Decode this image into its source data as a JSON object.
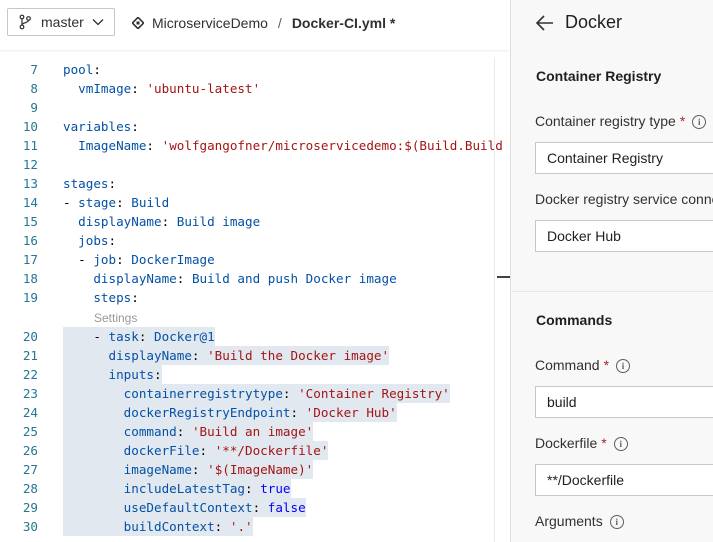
{
  "header": {
    "branch": "master",
    "repo": "MicroserviceDemo",
    "separator": "/",
    "file": "Docker-CI.yml *"
  },
  "editor": {
    "codelens": "Settings",
    "lines": [
      {
        "n": "7",
        "t": "pool:"
      },
      {
        "n": "8",
        "t": "  vmImage: 'ubuntu-latest'"
      },
      {
        "n": "9",
        "t": ""
      },
      {
        "n": "10",
        "t": "variables:"
      },
      {
        "n": "11",
        "t": "  ImageName: 'wolfgangofner/microservicedemo:$(Build.Build"
      },
      {
        "n": "12",
        "t": ""
      },
      {
        "n": "13",
        "t": "stages:"
      },
      {
        "n": "14",
        "t": "- stage: Build"
      },
      {
        "n": "15",
        "t": "  displayName: Build image"
      },
      {
        "n": "16",
        "t": "  jobs:"
      },
      {
        "n": "17",
        "t": "  - job: DockerImage"
      },
      {
        "n": "18",
        "t": "    displayName: Build and push Docker image"
      },
      {
        "n": "19",
        "t": "    steps:"
      },
      {
        "n": "20",
        "t": "    - task: Docker@1"
      },
      {
        "n": "21",
        "t": "      displayName: 'Build the Docker image'"
      },
      {
        "n": "22",
        "t": "      inputs:"
      },
      {
        "n": "23",
        "t": "        containerregistrytype: 'Container Registry'"
      },
      {
        "n": "24",
        "t": "        dockerRegistryEndpoint: 'Docker Hub'"
      },
      {
        "n": "25",
        "t": "        command: 'Build an image'"
      },
      {
        "n": "26",
        "t": "        dockerFile: '**/Dockerfile'"
      },
      {
        "n": "27",
        "t": "        imageName: '$(ImageName)'"
      },
      {
        "n": "28",
        "t": "        includeLatestTag: true"
      },
      {
        "n": "29",
        "t": "        useDefaultContext: false"
      },
      {
        "n": "30",
        "t": "        buildContext: '.'"
      }
    ]
  },
  "panel": {
    "title": "Docker",
    "section_registry": "Container Registry",
    "registry_type_label": "Container registry type",
    "registry_type_value": "Container Registry",
    "service_conn_label": "Docker registry service conne",
    "service_conn_value": "Docker Hub",
    "section_commands": "Commands",
    "command_label": "Command",
    "command_value": "build",
    "dockerfile_label": "Dockerfile",
    "dockerfile_value": "**/Dockerfile",
    "arguments_label": "Arguments",
    "required_mark": "*",
    "info_glyph": "i"
  },
  "colors": {
    "key": "#0451a5",
    "string": "#a31515",
    "bool": "#0000ff",
    "line_number": "#237893",
    "selection": "#e2e8ef",
    "required": "#a4262c"
  }
}
